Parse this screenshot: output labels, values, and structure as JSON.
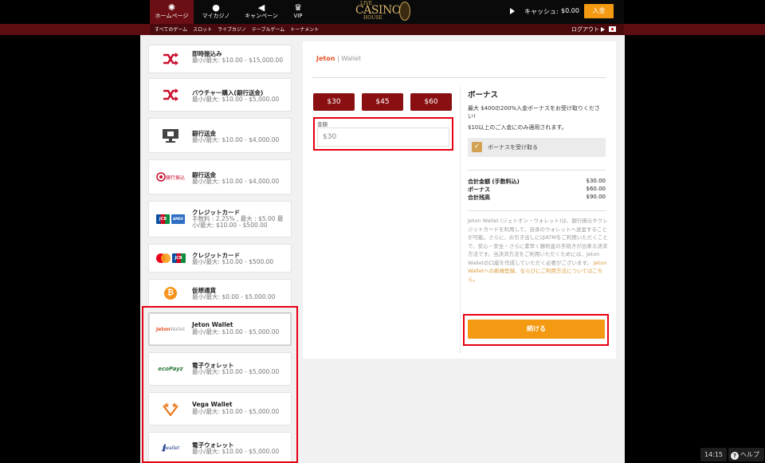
{
  "header": {
    "nav": [
      {
        "label": "ホームページ",
        "icon": "casino-chip-icon"
      },
      {
        "label": "マイカジノ",
        "icon": "user-icon"
      },
      {
        "label": "キャンペーン",
        "icon": "megaphone-icon"
      },
      {
        "label": "VIP",
        "icon": "crown-icon"
      }
    ],
    "logo": {
      "line1": "LIVE",
      "line2": "CASINO",
      "line3": "HOUSE"
    },
    "cash_label": "キャッシュ:",
    "cash_value": "$0.00",
    "deposit_label": "入金"
  },
  "subnav": {
    "links": [
      "すべてのゲーム",
      "スロット",
      "ライブカジノ",
      "テーブルゲーム",
      "トーナメント"
    ],
    "logout_label": "ログアウト"
  },
  "payment_methods": [
    {
      "name": "即時振込み",
      "info": "最小/最大: $10.00 - $15,000.00",
      "icon": "shuffle-icon"
    },
    {
      "name": "バウチャー購入(銀行送金)",
      "info": "最小/最大: $10.00 - $5,000.00",
      "icon": "shuffle-icon"
    },
    {
      "name": "銀行送金",
      "info": "最小/最大: $10.00 - $4,000.00",
      "icon": "bank-terminal-icon"
    },
    {
      "name": "銀行送金",
      "info": "最小/最大: $10.00 - $4,000.00",
      "icon": "bank-transfer-logo-icon"
    },
    {
      "name": "クレジットカード",
      "info": "手数料 : 2.25% , 最大 : $5.00 最小/最大: $10.00 - $500.00",
      "icon": "jcb-amex-icon"
    },
    {
      "name": "クレジットカード",
      "info": "最小/最大: $10.00 - $500.00",
      "icon": "mastercard-jcb-icon"
    },
    {
      "name": "仮想通貨",
      "info": "最小/最大: $0.00 - $5,000.00",
      "icon": "bitcoin-icon"
    },
    {
      "name": "Jeton Wallet",
      "info": "最小/最大: $10.00 - $5,000.00",
      "icon": "jeton-wallet-logo-icon"
    },
    {
      "name": "電子ウォレット",
      "info": "最小/最大: $10.00 - $5,000.00",
      "icon": "ecopayz-logo-icon"
    },
    {
      "name": "Vega Wallet",
      "info": "最小/最大: $10.00 - $5,000.00",
      "icon": "vega-wallet-logo-icon"
    },
    {
      "name": "電子ウォレット",
      "info": "最小/最大: $10.00 - $5,000.00",
      "icon": "iwallet-logo-icon"
    }
  ],
  "logos": {
    "jeton": "Jeton",
    "wallet": "Wallet",
    "ecopayz": "ecoPayz",
    "iwallet": "wallet",
    "jcb": "JCB",
    "amex": "AMEX",
    "bitcoin": "₿",
    "bank_text": "銀行振込"
  },
  "deposit": {
    "method_logo_jeton": "Jeton",
    "method_logo_wallet": "Wallet",
    "amounts": [
      "$30",
      "$45",
      "$60"
    ],
    "amount_label": "金額",
    "amount_value": "$30"
  },
  "bonus": {
    "title": "ボーナス",
    "description": "最大 $400の200%入金ボーナスをお受け取りください!",
    "note": "$10以上のご入金にのみ適用されます。",
    "accept_label": "ボーナスを受け取る",
    "accepted": true,
    "summary": [
      {
        "label": "合計金額 (手数料込)",
        "value": "$30.00"
      },
      {
        "label": "ボーナス",
        "value": "$60.00"
      },
      {
        "label": "合計残高",
        "value": "$90.00"
      }
    ],
    "jeton_desc": "Jeton Wallet (ジェトオン・ウォレット)は、銀行振込やクレジットカードを利用して、自身のウォレットへ送金することが可能。さらに、お引き出しにはATMをご利用いただくことで、安心・安全・さらに素早く勝利金の手続きが出来る決済方法です。当決済方法をご利用いただくためには、Jeton Walletの口座を作成していただく必要がございます。",
    "jeton_link": "Jeton Walletへの新規登録、ならびにご利用方法についてはこちら。",
    "continue_label": "続ける"
  },
  "footer": {
    "time": "14:15",
    "help_label": "ヘルプ"
  },
  "colors": {
    "accent": "#f39a12",
    "brand_dark_red": "#8a0f12",
    "highlight_red": "#e60012",
    "checkbox_gold": "#d2a252"
  }
}
